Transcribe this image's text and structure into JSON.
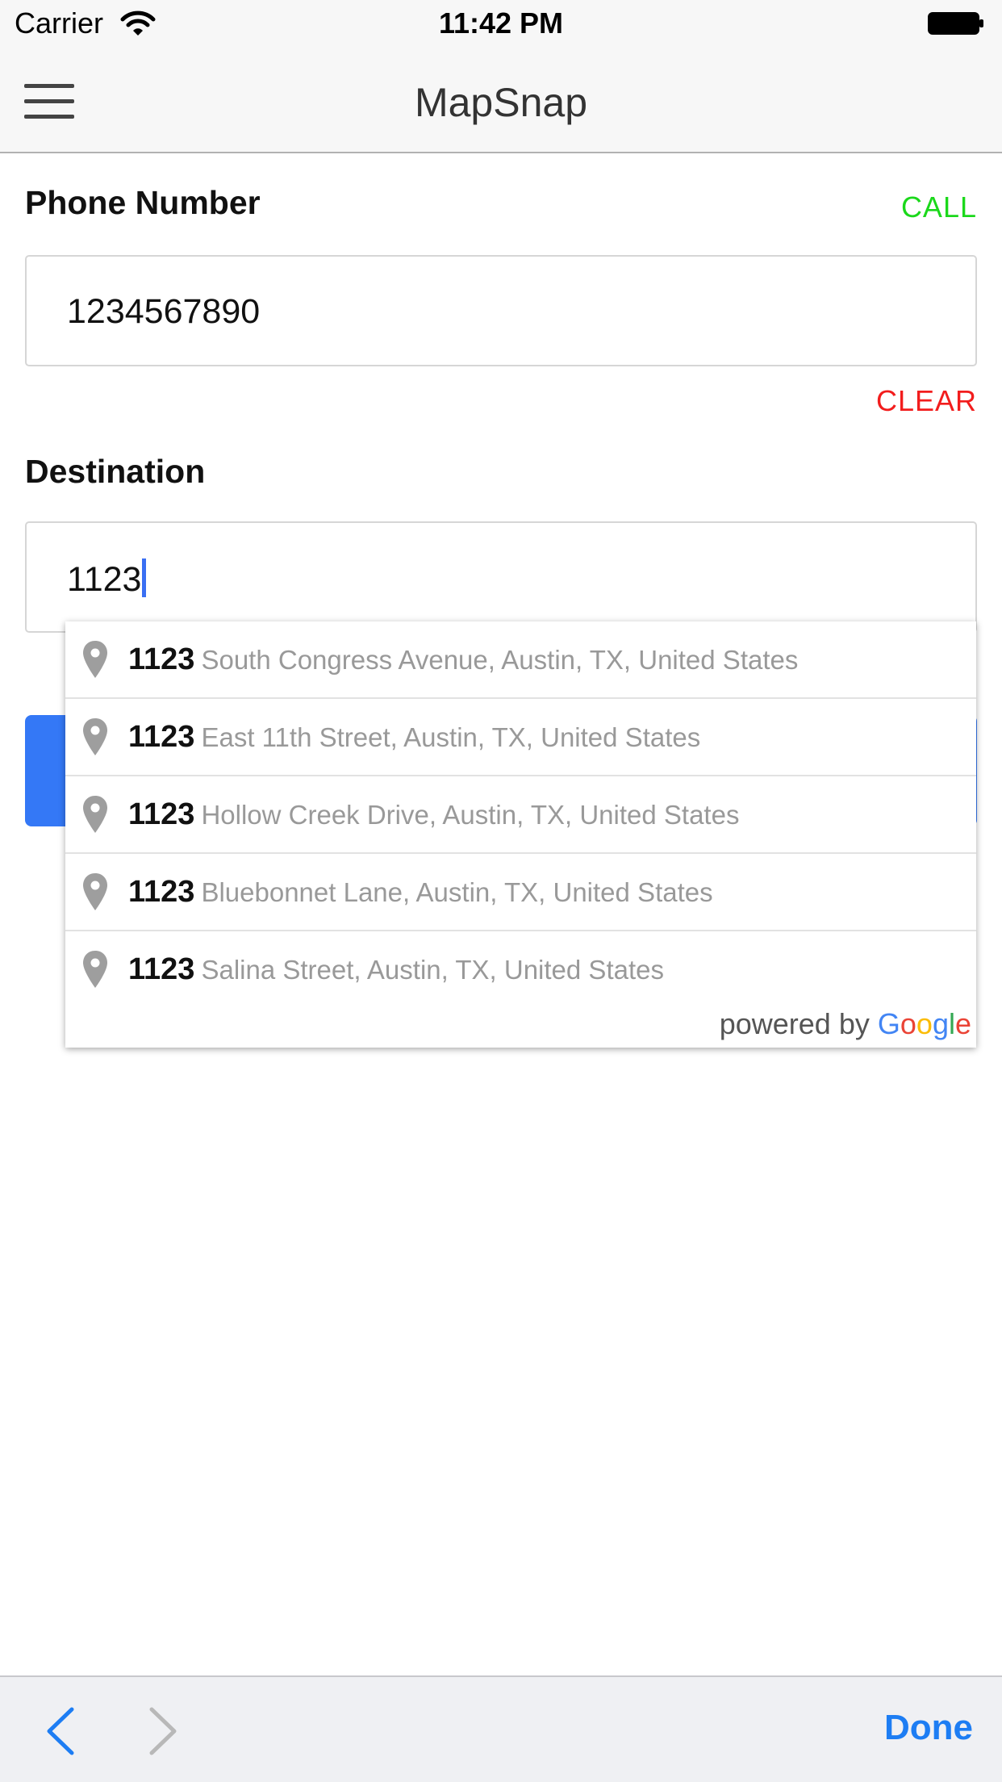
{
  "status_bar": {
    "carrier": "Carrier",
    "time": "11:42 PM",
    "icons": [
      "wifi-icon",
      "battery-icon"
    ]
  },
  "nav": {
    "title": "MapSnap",
    "menu_icon": "hamburger-menu-icon"
  },
  "phone": {
    "label": "Phone Number",
    "call_label": "CALL",
    "value": "1234567890",
    "clear_label": "CLEAR"
  },
  "destination": {
    "label": "Destination",
    "value": "1123"
  },
  "autocomplete": {
    "suggestions": [
      {
        "match": "1123",
        "rest": "South Congress Avenue, Austin, TX, United States"
      },
      {
        "match": "1123",
        "rest": "East 11th Street, Austin, TX, United States"
      },
      {
        "match": "1123",
        "rest": "Hollow Creek Drive, Austin, TX, United States"
      },
      {
        "match": "1123",
        "rest": "Bluebonnet Lane, Austin, TX, United States"
      },
      {
        "match": "1123",
        "rest": "Salina Street, Austin, TX, United States"
      }
    ],
    "powered_by": "powered by",
    "google": [
      "G",
      "o",
      "o",
      "g",
      "l",
      "e"
    ]
  },
  "toolbar": {
    "done_label": "Done",
    "prev_icon": "chevron-left-icon",
    "next_icon": "chevron-right-icon"
  },
  "colors": {
    "call": "#1bd81b",
    "clear": "#f21d1d",
    "accent": "#3478f6",
    "done": "#1d7df3"
  }
}
